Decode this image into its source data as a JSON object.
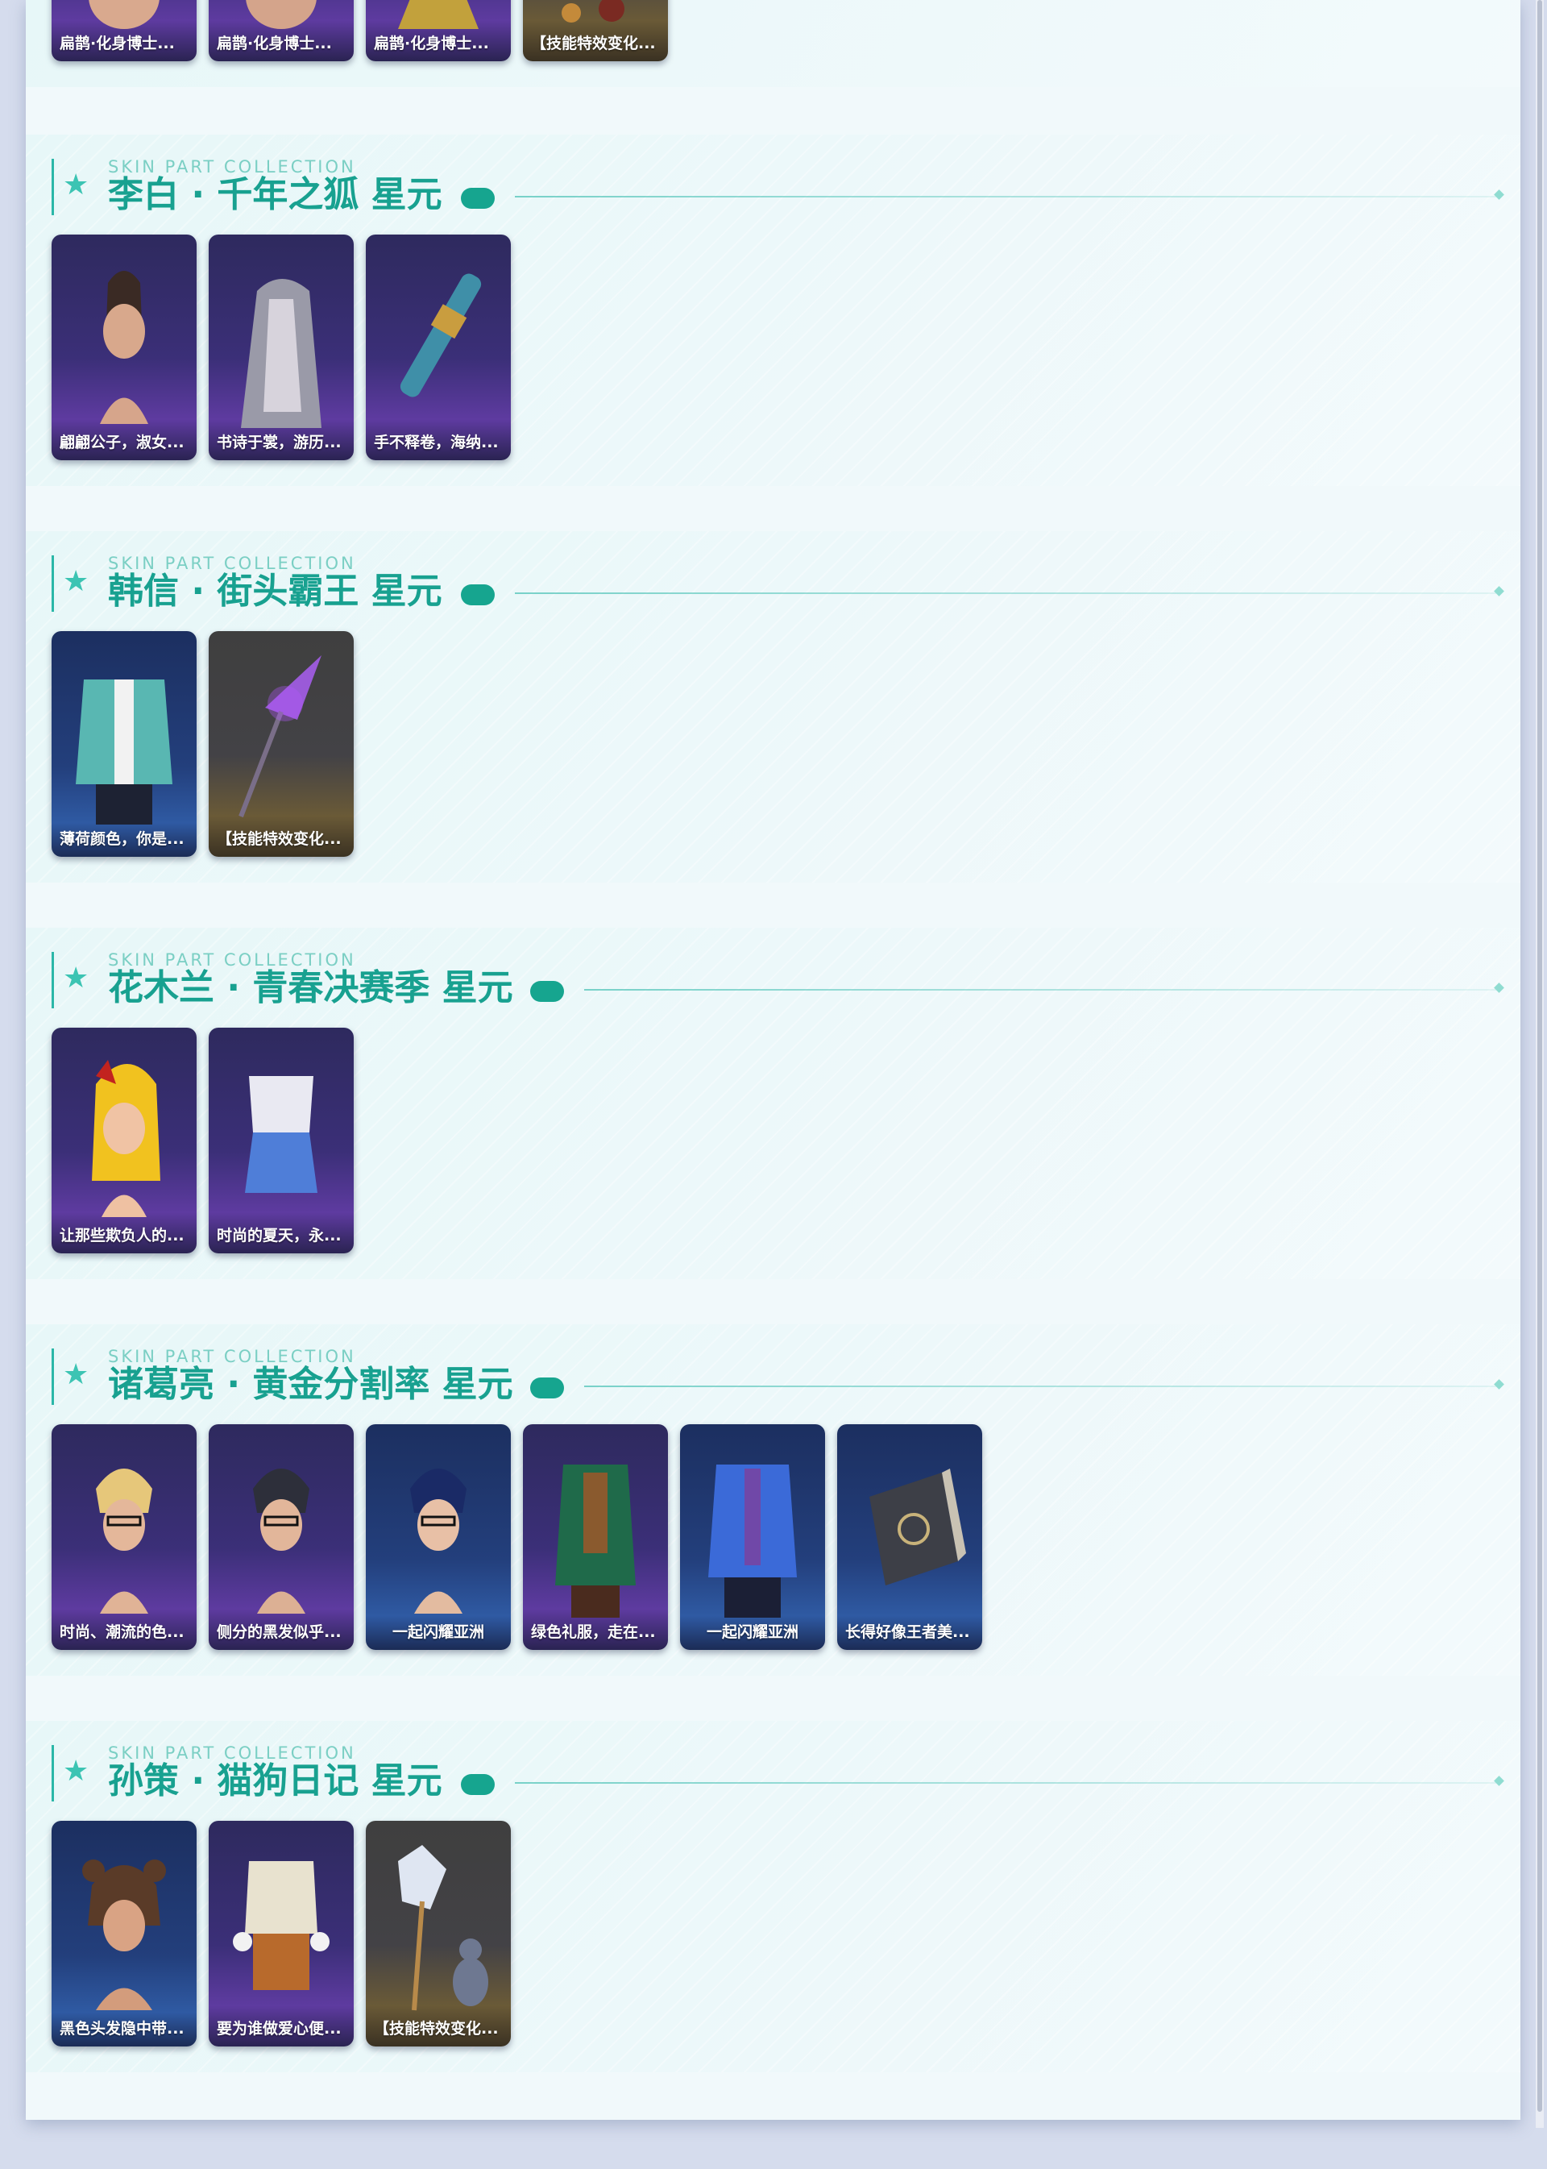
{
  "sections": [
    {
      "id": "prev",
      "cards": [
        {
          "label": "扁鹊·化身博士...",
          "tone": "purple",
          "icon": "head-portrait-icon"
        },
        {
          "label": "扁鹊·化身博士...",
          "tone": "purple",
          "icon": "head-portrait-icon"
        },
        {
          "label": "扁鹊·化身博士...",
          "tone": "purple",
          "icon": "costume-icon"
        },
        {
          "label": "【技能特效变化...",
          "tone": "gold",
          "icon": "skill-effect-icon"
        }
      ]
    },
    {
      "id": "libai",
      "kicker": "SKIN PART COLLECTION",
      "title": "李白 · 千年之狐 星元",
      "cards": [
        {
          "label": "翩翩公子，淑女...",
          "tone": "purple",
          "icon": "head-portrait-icon"
        },
        {
          "label": "书诗于裳，游历...",
          "tone": "purple",
          "icon": "costume-icon"
        },
        {
          "label": "手不释卷，海纳...",
          "tone": "purple",
          "icon": "weapon-scroll-icon"
        }
      ]
    },
    {
      "id": "hanxin",
      "kicker": "SKIN PART COLLECTION",
      "title": "韩信 · 街头霸王 星元",
      "cards": [
        {
          "label": "薄荷颜色，你是...",
          "tone": "blue",
          "icon": "costume-icon"
        },
        {
          "label": "【技能特效变化...",
          "tone": "gold",
          "icon": "spear-weapon-icon"
        }
      ]
    },
    {
      "id": "mulan",
      "kicker": "SKIN PART COLLECTION",
      "title": "花木兰 · 青春决赛季 星元",
      "cards": [
        {
          "label": "让那些欺负人的...",
          "tone": "purple",
          "icon": "head-portrait-icon"
        },
        {
          "label": "时尚的夏天，永...",
          "tone": "purple",
          "icon": "costume-icon"
        }
      ]
    },
    {
      "id": "zhugeliang",
      "kicker": "SKIN PART COLLECTION",
      "title": "诸葛亮 · 黄金分割率 星元",
      "cards": [
        {
          "label": "时尚、潮流的色...",
          "tone": "purple",
          "icon": "head-portrait-icon"
        },
        {
          "label": "侧分的黑发似乎...",
          "tone": "purple",
          "icon": "head-portrait-icon"
        },
        {
          "label": "一起闪耀亚洲",
          "tone": "blue",
          "icon": "head-portrait-icon",
          "center": true
        },
        {
          "label": "绿色礼服，走在...",
          "tone": "purple",
          "icon": "costume-icon"
        },
        {
          "label": "一起闪耀亚洲",
          "tone": "blue",
          "icon": "costume-icon",
          "center": true
        },
        {
          "label": "长得好像王者美...",
          "tone": "blue",
          "icon": "book-icon"
        }
      ]
    },
    {
      "id": "sunce",
      "kicker": "SKIN PART COLLECTION",
      "title": "孙策 · 猫狗日记 星元",
      "cards": [
        {
          "label": "黑色头发隐中带...",
          "tone": "blue",
          "icon": "head-portrait-icon"
        },
        {
          "label": "要为谁做爱心便...",
          "tone": "purple",
          "icon": "costume-icon"
        },
        {
          "label": "【技能特效变化...",
          "tone": "gold",
          "icon": "pet-effect-icon"
        }
      ]
    }
  ]
}
